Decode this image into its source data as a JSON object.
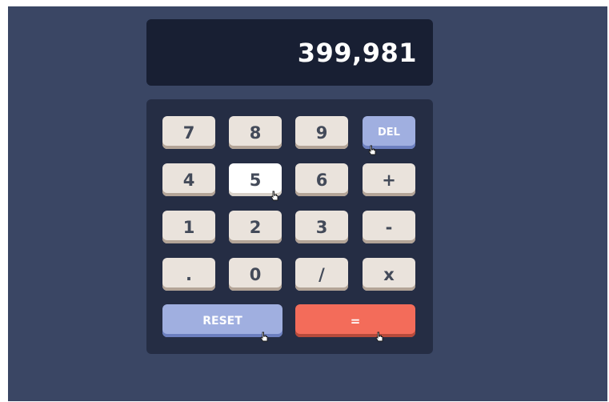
{
  "display": {
    "value": "399,981"
  },
  "keys": {
    "row1": [
      "7",
      "8",
      "9"
    ],
    "del_label": "DEL",
    "row2": [
      "4",
      "5",
      "6"
    ],
    "plus_label": "+",
    "row3": [
      "1",
      "2",
      "3"
    ],
    "minus_label": "-",
    "row4": [
      ".",
      "0",
      "/"
    ],
    "multiply_label": "x",
    "reset_label": "RESET",
    "equals_label": "="
  },
  "colors": {
    "background": "#3a4664",
    "screen": "#181f33",
    "keypad": "#252d44",
    "key": "#eae3dc",
    "key_text": "#434a59",
    "accent_blue": "#a0afe0",
    "accent_red": "#f36c5a"
  },
  "icons": {
    "cursor": "hand-pointer-cursor-icon"
  }
}
